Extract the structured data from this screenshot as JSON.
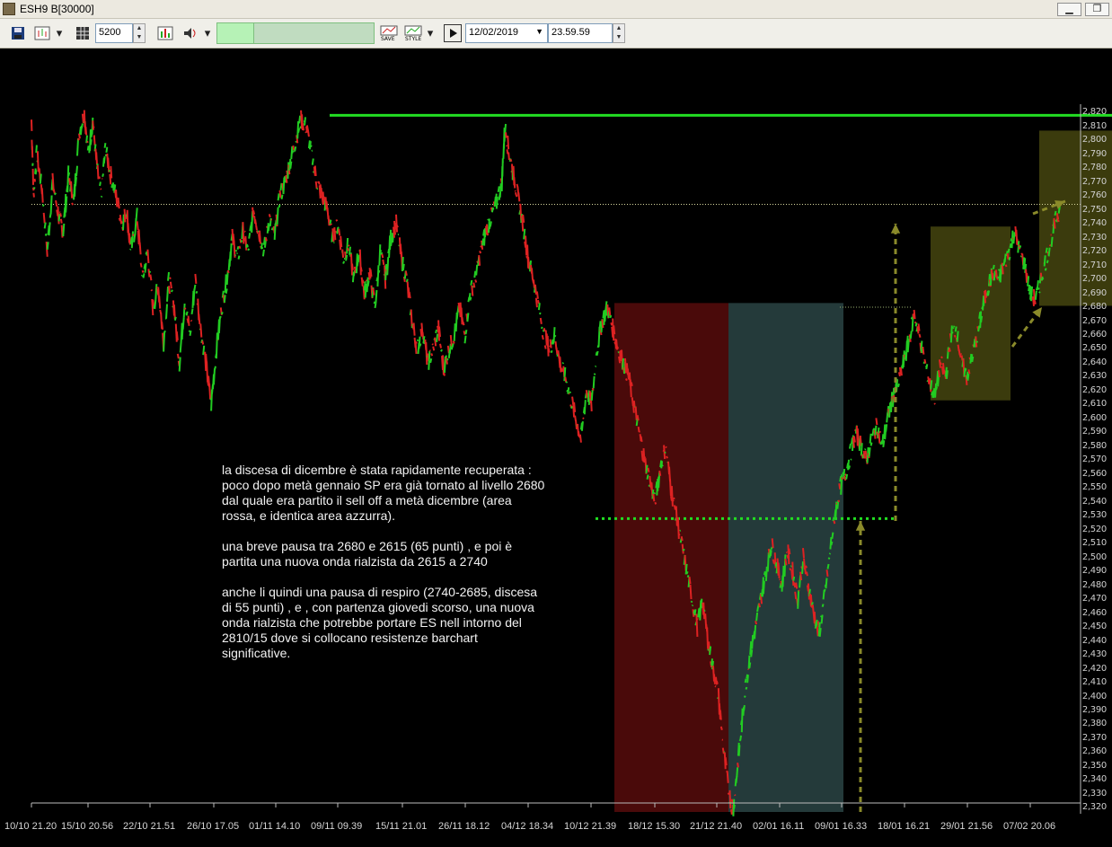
{
  "window": {
    "title": "ESH9 B[30000]",
    "buttons": [
      "minimize",
      "restore"
    ]
  },
  "toolbar": {
    "bars_value": "5200",
    "date_value": "12/02/2019",
    "time_value": "23.59.59",
    "icons": [
      "save-icon",
      "chart-type-icon",
      "dropdown-icon",
      "grid-icon",
      "bar-chart-icon",
      "sound-icon",
      "save-study-icon",
      "style-icon",
      "play-icon"
    ]
  },
  "chart_data": {
    "type": "line",
    "symbol": "ESH9",
    "ylim": [
      2317,
      2826
    ],
    "y_ticks": [
      2820,
      2810,
      2800,
      2790,
      2780,
      2770,
      2760,
      2750,
      2740,
      2730,
      2720,
      2710,
      2700,
      2690,
      2680,
      2670,
      2660,
      2650,
      2640,
      2630,
      2620,
      2610,
      2600,
      2590,
      2580,
      2570,
      2560,
      2550,
      2540,
      2530,
      2520,
      2510,
      2500,
      2490,
      2480,
      2470,
      2460,
      2450,
      2440,
      2430,
      2420,
      2410,
      2400,
      2390,
      2380,
      2370,
      2360,
      2350,
      2340,
      2330,
      2320
    ],
    "x_labels": [
      "10/10 21.20",
      "15/10 20.56",
      "22/10 21.51",
      "26/10 17.05",
      "01/11 14.10",
      "09/11 09.39",
      "15/11 21.01",
      "26/11 18.12",
      "04/12 18.34",
      "10/12 21.39",
      "18/12 15.30",
      "21/12 21.40",
      "02/01 16.11",
      "09/01 16.33",
      "18/01 16.21",
      "29/01 21.56",
      "07/02 20.06"
    ],
    "price_path": [
      [
        0,
        2815
      ],
      [
        0.2,
        2760
      ],
      [
        0.5,
        2790
      ],
      [
        1.0,
        2765
      ],
      [
        1.5,
        2720
      ],
      [
        2.0,
        2770
      ],
      [
        2.6,
        2745
      ],
      [
        3.0,
        2735
      ],
      [
        3.5,
        2775
      ],
      [
        4.0,
        2755
      ],
      [
        4.5,
        2805
      ],
      [
        5.0,
        2820
      ],
      [
        5.4,
        2790
      ],
      [
        5.8,
        2815
      ],
      [
        6.2,
        2780
      ],
      [
        6.6,
        2760
      ],
      [
        7.0,
        2795
      ],
      [
        7.5,
        2775
      ],
      [
        8.0,
        2760
      ],
      [
        8.6,
        2740
      ],
      [
        9.0,
        2750
      ],
      [
        9.4,
        2720
      ],
      [
        10.0,
        2745
      ],
      [
        10.5,
        2700
      ],
      [
        11.0,
        2720
      ],
      [
        11.5,
        2680
      ],
      [
        12.0,
        2695
      ],
      [
        12.5,
        2655
      ],
      [
        13.0,
        2700
      ],
      [
        13.5,
        2680
      ],
      [
        14.0,
        2640
      ],
      [
        14.5,
        2685
      ],
      [
        15.0,
        2660
      ],
      [
        15.5,
        2700
      ],
      [
        16.0,
        2665
      ],
      [
        16.5,
        2640
      ],
      [
        17.0,
        2610
      ],
      [
        17.5,
        2650
      ],
      [
        18.0,
        2680
      ],
      [
        18.5,
        2700
      ],
      [
        19.0,
        2730
      ],
      [
        19.5,
        2715
      ],
      [
        20.0,
        2735
      ],
      [
        20.5,
        2720
      ],
      [
        21.0,
        2750
      ],
      [
        21.5,
        2735
      ],
      [
        22.0,
        2720
      ],
      [
        22.5,
        2745
      ],
      [
        23.0,
        2730
      ],
      [
        23.5,
        2760
      ],
      [
        24.0,
        2770
      ],
      [
        24.5,
        2785
      ],
      [
        25.0,
        2800
      ],
      [
        25.5,
        2815
      ],
      [
        26.0,
        2810
      ],
      [
        26.5,
        2790
      ],
      [
        27.0,
        2770
      ],
      [
        27.5,
        2760
      ],
      [
        28.0,
        2750
      ],
      [
        28.5,
        2730
      ],
      [
        29.0,
        2740
      ],
      [
        29.5,
        2715
      ],
      [
        30.0,
        2725
      ],
      [
        30.5,
        2700
      ],
      [
        31.0,
        2720
      ],
      [
        31.5,
        2690
      ],
      [
        32.0,
        2705
      ],
      [
        32.5,
        2680
      ],
      [
        33.0,
        2720
      ],
      [
        33.5,
        2700
      ],
      [
        34.0,
        2730
      ],
      [
        34.5,
        2740
      ],
      [
        35.0,
        2715
      ],
      [
        35.5,
        2700
      ],
      [
        36.0,
        2670
      ],
      [
        36.5,
        2650
      ],
      [
        37.0,
        2665
      ],
      [
        37.5,
        2640
      ],
      [
        38.0,
        2650
      ],
      [
        38.5,
        2665
      ],
      [
        39.0,
        2635
      ],
      [
        39.5,
        2650
      ],
      [
        40.0,
        2660
      ],
      [
        40.5,
        2680
      ],
      [
        41.0,
        2660
      ],
      [
        41.5,
        2690
      ],
      [
        42.0,
        2700
      ],
      [
        42.5,
        2720
      ],
      [
        43.0,
        2735
      ],
      [
        43.5,
        2745
      ],
      [
        44.0,
        2755
      ],
      [
        44.5,
        2770
      ],
      [
        44.8,
        2810
      ],
      [
        45.2,
        2790
      ],
      [
        45.6,
        2775
      ],
      [
        46.0,
        2760
      ],
      [
        46.5,
        2740
      ],
      [
        47.0,
        2715
      ],
      [
        47.5,
        2700
      ],
      [
        48.0,
        2680
      ],
      [
        48.5,
        2660
      ],
      [
        49.0,
        2650
      ],
      [
        49.5,
        2660
      ],
      [
        50.0,
        2640
      ],
      [
        50.5,
        2630
      ],
      [
        51.0,
        2615
      ],
      [
        51.5,
        2600
      ],
      [
        52.0,
        2585
      ],
      [
        52.5,
        2620
      ],
      [
        53.0,
        2610
      ],
      [
        53.5,
        2650
      ],
      [
        54.0,
        2670
      ],
      [
        54.5,
        2680
      ],
      [
        55.0,
        2665
      ],
      [
        55.5,
        2650
      ],
      [
        56.0,
        2640
      ],
      [
        56.5,
        2630
      ],
      [
        57.0,
        2610
      ],
      [
        57.5,
        2590
      ],
      [
        58.0,
        2570
      ],
      [
        58.5,
        2555
      ],
      [
        59.0,
        2540
      ],
      [
        59.5,
        2565
      ],
      [
        60.0,
        2580
      ],
      [
        60.5,
        2550
      ],
      [
        61.0,
        2530
      ],
      [
        61.5,
        2510
      ],
      [
        62.0,
        2490
      ],
      [
        62.5,
        2470
      ],
      [
        63.0,
        2450
      ],
      [
        63.5,
        2470
      ],
      [
        64.0,
        2440
      ],
      [
        64.5,
        2420
      ],
      [
        65.0,
        2400
      ],
      [
        65.5,
        2360
      ],
      [
        66.0,
        2330
      ],
      [
        66.4,
        2318
      ],
      [
        66.8,
        2350
      ],
      [
        67.2,
        2380
      ],
      [
        67.6,
        2410
      ],
      [
        68.0,
        2430
      ],
      [
        68.5,
        2450
      ],
      [
        69.0,
        2470
      ],
      [
        69.5,
        2490
      ],
      [
        70.0,
        2510
      ],
      [
        70.5,
        2495
      ],
      [
        71.0,
        2480
      ],
      [
        71.5,
        2505
      ],
      [
        72.0,
        2490
      ],
      [
        72.5,
        2470
      ],
      [
        73.0,
        2500
      ],
      [
        73.5,
        2480
      ],
      [
        74.0,
        2460
      ],
      [
        74.5,
        2445
      ],
      [
        75.0,
        2470
      ],
      [
        75.5,
        2500
      ],
      [
        76.0,
        2530
      ],
      [
        76.5,
        2550
      ],
      [
        77.0,
        2560
      ],
      [
        77.5,
        2575
      ],
      [
        78.0,
        2590
      ],
      [
        78.5,
        2580
      ],
      [
        79.0,
        2570
      ],
      [
        79.5,
        2585
      ],
      [
        80.0,
        2595
      ],
      [
        80.5,
        2580
      ],
      [
        81.0,
        2600
      ],
      [
        81.5,
        2615
      ],
      [
        82.0,
        2625
      ],
      [
        82.5,
        2640
      ],
      [
        83.0,
        2655
      ],
      [
        83.5,
        2675
      ],
      [
        84.0,
        2660
      ],
      [
        84.5,
        2640
      ],
      [
        85.0,
        2625
      ],
      [
        85.5,
        2615
      ],
      [
        86.0,
        2640
      ],
      [
        86.5,
        2630
      ],
      [
        87.0,
        2660
      ],
      [
        87.5,
        2665
      ],
      [
        88.0,
        2640
      ],
      [
        88.5,
        2630
      ],
      [
        89.0,
        2645
      ],
      [
        89.5,
        2660
      ],
      [
        90.0,
        2680
      ],
      [
        90.5,
        2695
      ],
      [
        91.0,
        2705
      ],
      [
        91.5,
        2700
      ],
      [
        92.0,
        2710
      ],
      [
        92.5,
        2720
      ],
      [
        93.0,
        2735
      ],
      [
        93.5,
        2720
      ],
      [
        94.0,
        2710
      ],
      [
        94.5,
        2690
      ],
      [
        95.0,
        2685
      ],
      [
        95.5,
        2700
      ],
      [
        96.0,
        2715
      ],
      [
        96.5,
        2730
      ],
      [
        97.0,
        2745
      ],
      [
        97.3,
        2750
      ]
    ],
    "resistance_level": 2818,
    "dotted_level": 2754,
    "support_level": 2528,
    "dotted_level_2": 2680,
    "colors": {
      "up": "#22cc22",
      "down": "#dd2222",
      "resistance_line": "#22dd22",
      "support_line": "#22dd22",
      "red_zone": "#4a0a0a",
      "blue_zone": "#243a3a",
      "olive_box": "#4a4a10",
      "arrow": "#8a8a2a"
    }
  },
  "commentary": {
    "p1": "la discesa di dicembre è stata rapidamente recuperata : poco dopo metà gennaio SP era già tornato al livello 2680  dal quale era partito il sell off a metà dicembre (area rossa, e identica area azzurra).",
    "p2": "una breve pausa tra 2680 e 2615 (65 punti) , e poi è partita una nuova onda rialzista da 2615 a 2740",
    "p3": "anche li quindi una pausa di respiro (2740-2685, discesa di 55 punti) , e , con partenza giovedi scorso, una nuova onda rialzista che potrebbe portare ES nell intorno del 2810/15 dove si collocano resistenze barchart significative."
  }
}
